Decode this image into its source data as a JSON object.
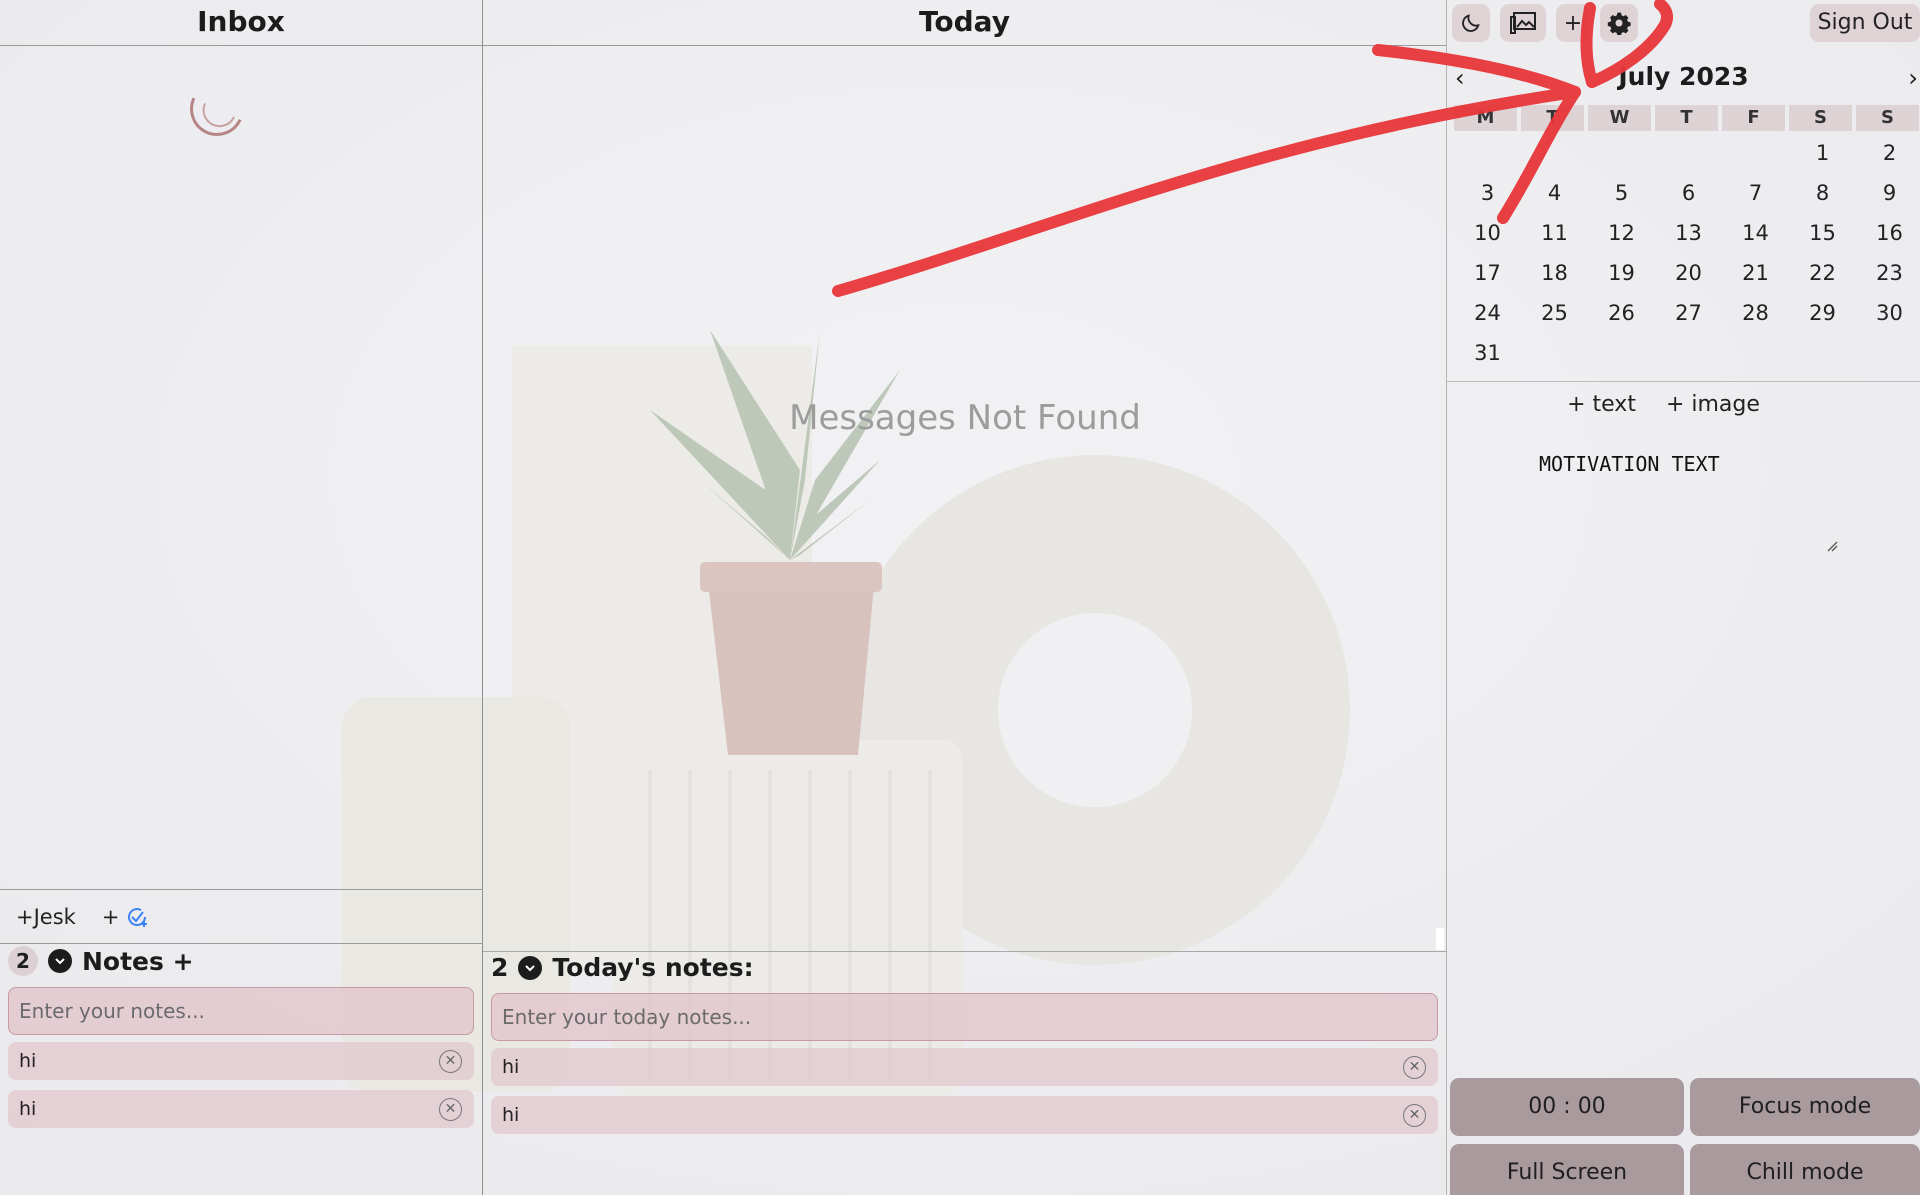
{
  "inbox": {
    "title": "Inbox",
    "actions": {
      "desk_label": "+Jesk",
      "add_label": "+"
    },
    "notes": {
      "count": "2",
      "title": "Notes +",
      "placeholder": "Enter your notes...",
      "items": [
        {
          "text": "hi"
        },
        {
          "text": "hi"
        }
      ]
    }
  },
  "today": {
    "title": "Today",
    "empty_message": "Messages Not Found",
    "notes": {
      "count": "2",
      "title": "Today's notes:",
      "placeholder": "Enter your today notes...",
      "items": [
        {
          "text": "hi"
        },
        {
          "text": "hi"
        }
      ]
    }
  },
  "toolbar": {
    "add_label": "+",
    "sign_out_label": "Sign Out",
    "icons": [
      "moon-icon",
      "image-icon",
      "plus-icon",
      "gear-icon"
    ]
  },
  "calendar": {
    "month_label": "July 2023",
    "prev": "‹",
    "next": "›",
    "weekdays": [
      "M",
      "T",
      "W",
      "T",
      "F",
      "S",
      "S"
    ],
    "days": [
      "",
      "",
      "",
      "",
      "",
      "1",
      "2",
      "3",
      "4",
      "5",
      "6",
      "7",
      "8",
      "9",
      "10",
      "11",
      "12",
      "13",
      "14",
      "15",
      "16",
      "17",
      "18",
      "19",
      "20",
      "21",
      "22",
      "23",
      "24",
      "25",
      "26",
      "27",
      "28",
      "29",
      "30",
      "31",
      "",
      "",
      "",
      "",
      "",
      ""
    ]
  },
  "widgets": {
    "add_text_label": "+ text",
    "add_image_label": "+ image",
    "motivation_text": "MOTIVATION TEXT"
  },
  "controls": {
    "timer": "00 : 00",
    "focus_mode": "Focus mode",
    "full_screen": "Full Screen",
    "chill_mode": "Chill mode"
  },
  "colors": {
    "accent_pink": "#e2c4cb",
    "button_mauve": "#a89a9d",
    "annotation_red": "#e8363a",
    "check_icon_blue": "#3b82f6"
  }
}
